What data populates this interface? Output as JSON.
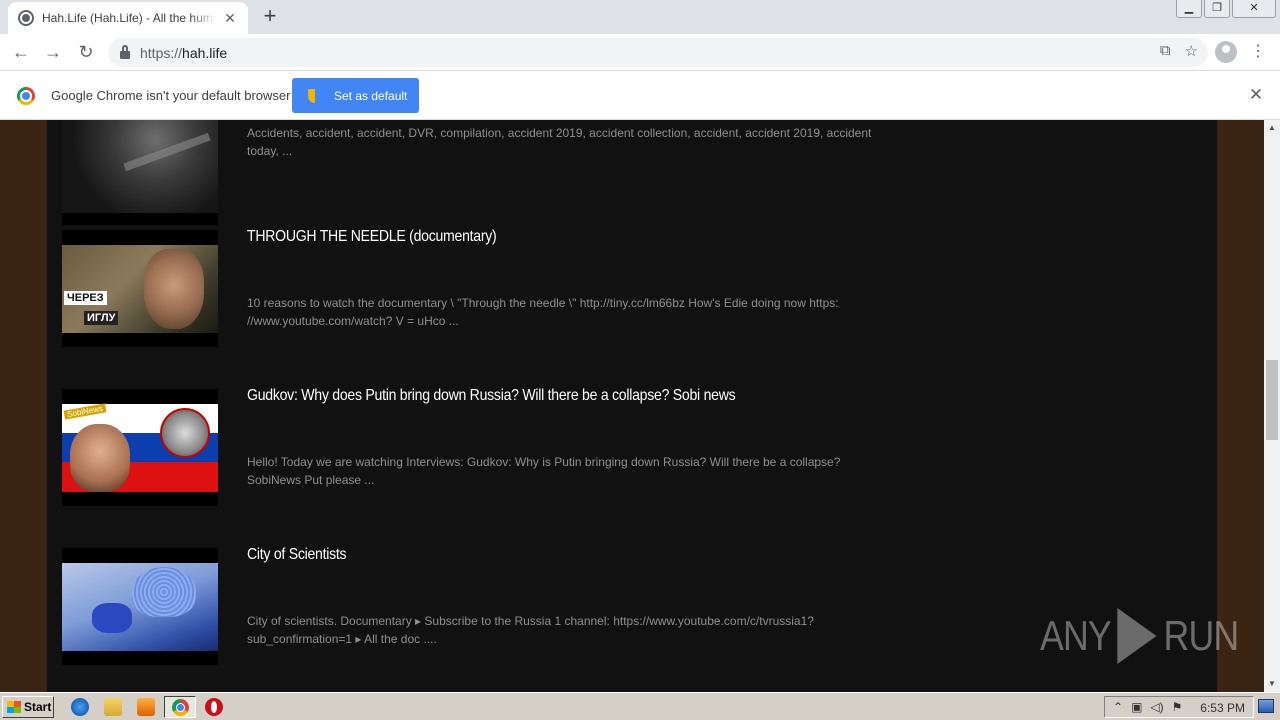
{
  "browser": {
    "tab_title": "Hah.Life (Hah.Life) - All the humor in",
    "tab_close": "✕",
    "new_tab": "+",
    "url_proto": "https://",
    "url_host": "hah.life",
    "infobar_text": "Google Chrome isn't your default browser",
    "set_default_label": "Set as default",
    "infobar_close": "✕"
  },
  "videos": [
    {
      "title": "",
      "description": "Accidents, accident, accident, DVR, compilation, accident 2019, accident collection, accident, accident 2019, accident today, ...",
      "thumb": "road-traffic"
    },
    {
      "title": "THROUGH THE NEEDLE (documentary)",
      "description": "10 reasons to watch the documentary \\ \"Through the needle \\\" http://tiny.cc/lm66bz How's Edie doing now https: //www.youtube.com/watch? V = uHco ...",
      "thumb": "needle",
      "thumb_caption_1": "ЧЕРЕЗ",
      "thumb_caption_2": "ИГЛУ"
    },
    {
      "title": "Gudkov: Why does Putin bring down Russia? Will there be a collapse? Sobi news",
      "description": "Hello! Today we are watching Interviews: Gudkov: Why is Putin bringing down Russia? Will there be a collapse? SobiNews Put please ...",
      "thumb": "flag-portrait",
      "thumb_caption_1": "SobiNews"
    },
    {
      "title": "City of Scientists",
      "description": "City of scientists. Documentary ▸ Subscribe to the Russia 1 channel: https://www.youtube.com/c/tvrussia1?sub_confirmation=1 ▸ All the doc ....",
      "thumb": "lab"
    }
  ],
  "watermark": {
    "left": "ANY",
    "right": "RUN"
  },
  "taskbar": {
    "start_label": "Start",
    "clock": "6:53 PM"
  }
}
